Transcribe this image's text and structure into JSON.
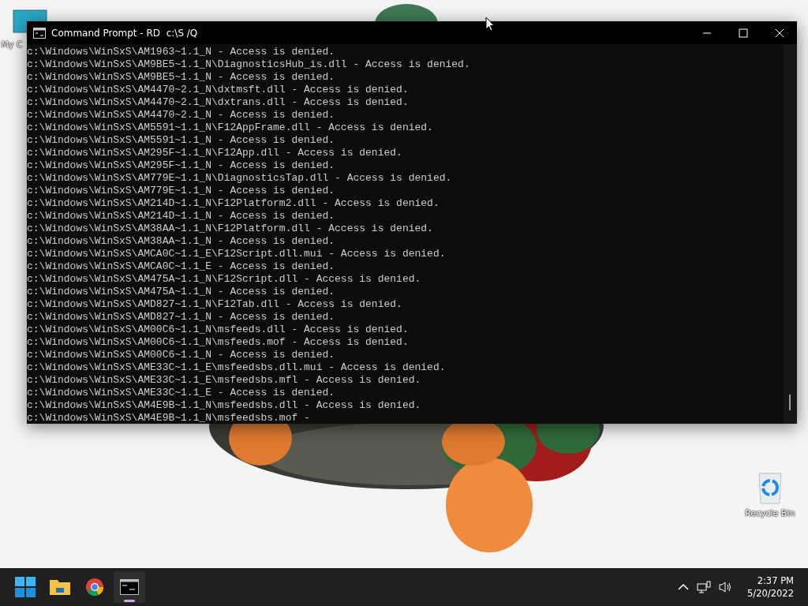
{
  "desktop": {
    "icons": [
      {
        "kind": "computer",
        "label": "My C"
      },
      {
        "kind": "recycle",
        "label": "Recycle Bin"
      }
    ]
  },
  "window": {
    "title": "Command Prompt - RD  c:\\S /Q",
    "lines": [
      "c:\\Windows\\WinSxS\\AM1963~1.1_N - Access is denied.",
      "c:\\Windows\\WinSxS\\AM9BE5~1.1_N\\DiagnosticsHub_is.dll - Access is denied.",
      "c:\\Windows\\WinSxS\\AM9BE5~1.1_N - Access is denied.",
      "c:\\Windows\\WinSxS\\AM4470~2.1_N\\dxtmsft.dll - Access is denied.",
      "c:\\Windows\\WinSxS\\AM4470~2.1_N\\dxtrans.dll - Access is denied.",
      "c:\\Windows\\WinSxS\\AM4470~2.1_N - Access is denied.",
      "c:\\Windows\\WinSxS\\AM5591~1.1_N\\F12AppFrame.dll - Access is denied.",
      "c:\\Windows\\WinSxS\\AM5591~1.1_N - Access is denied.",
      "c:\\Windows\\WinSxS\\AM295F~1.1_N\\F12App.dll - Access is denied.",
      "c:\\Windows\\WinSxS\\AM295F~1.1_N - Access is denied.",
      "c:\\Windows\\WinSxS\\AM779E~1.1_N\\DiagnosticsTap.dll - Access is denied.",
      "c:\\Windows\\WinSxS\\AM779E~1.1_N - Access is denied.",
      "c:\\Windows\\WinSxS\\AM214D~1.1_N\\F12Platform2.dll - Access is denied.",
      "c:\\Windows\\WinSxS\\AM214D~1.1_N - Access is denied.",
      "c:\\Windows\\WinSxS\\AM38AA~1.1_N\\F12Platform.dll - Access is denied.",
      "c:\\Windows\\WinSxS\\AM38AA~1.1_N - Access is denied.",
      "c:\\Windows\\WinSxS\\AMCA0C~1.1_E\\F12Script.dll.mui - Access is denied.",
      "c:\\Windows\\WinSxS\\AMCA0C~1.1_E - Access is denied.",
      "c:\\Windows\\WinSxS\\AM475A~1.1_N\\F12Script.dll - Access is denied.",
      "c:\\Windows\\WinSxS\\AM475A~1.1_N - Access is denied.",
      "c:\\Windows\\WinSxS\\AMD827~1.1_N\\F12Tab.dll - Access is denied.",
      "c:\\Windows\\WinSxS\\AMD827~1.1_N - Access is denied.",
      "c:\\Windows\\WinSxS\\AM00C6~1.1_N\\msfeeds.dll - Access is denied.",
      "c:\\Windows\\WinSxS\\AM00C6~1.1_N\\msfeeds.mof - Access is denied.",
      "c:\\Windows\\WinSxS\\AM00C6~1.1_N - Access is denied.",
      "c:\\Windows\\WinSxS\\AME33C~1.1_E\\msfeedsbs.dll.mui - Access is denied.",
      "c:\\Windows\\WinSxS\\AME33C~1.1_E\\msfeedsbs.mfl - Access is denied.",
      "c:\\Windows\\WinSxS\\AME33C~1.1_E - Access is denied.",
      "c:\\Windows\\WinSxS\\AM4E9B~1.1_N\\msfeedsbs.dll - Access is denied.",
      "c:\\Windows\\WinSxS\\AM4E9B~1.1_N\\msfeedsbs.mof -"
    ]
  },
  "taskbar": {
    "apps": [
      {
        "kind": "start",
        "selected": false
      },
      {
        "kind": "folder",
        "selected": false
      },
      {
        "kind": "browser",
        "selected": false
      },
      {
        "kind": "terminal",
        "selected": true
      }
    ],
    "time": "2:37 PM",
    "date": "5/20/2022"
  }
}
